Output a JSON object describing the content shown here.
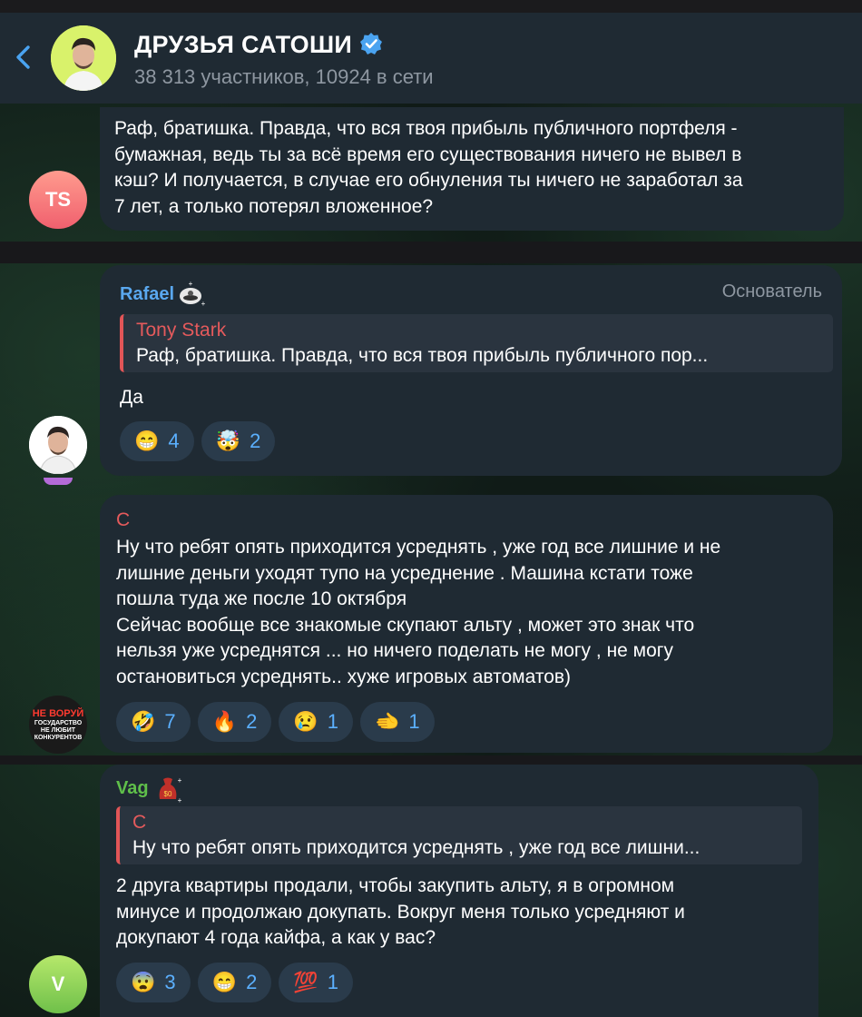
{
  "header": {
    "title": "ДРУЗЬЯ САТОШИ",
    "subtitle": "38 313 участников, 10924 в сети"
  },
  "messages": [
    {
      "avatar_initials": "TS",
      "text": "Раф, братишка. Правда, что вся твоя прибыль публичного портфеля -\nбумажная, ведь ты за всё время его существования ничего не вывел в\nкэш? И получается, в случае его обнуления ты ничего не заработал за\n7 лет, а только потерял вложенное?"
    },
    {
      "author": "Rafael",
      "role": "Основатель",
      "reply": {
        "author": "Tony Stark",
        "text": "Раф, братишка. Правда, что вся твоя прибыль публичного пор..."
      },
      "text": "Да",
      "reactions": [
        {
          "emoji": "😁",
          "count": "4"
        },
        {
          "emoji": "🤯",
          "count": "2"
        }
      ]
    },
    {
      "author": "С",
      "avatar_text": [
        "НЕ ВОРУЙ",
        "ГОСУДАРСТВО",
        "НЕ ЛЮБИТ",
        "КОНКУРЕНТОВ"
      ],
      "text": "Ну что ребят опять приходится усреднять , уже год все лишние и не\nлишние деньги уходят тупо на усреднение . Машина кстати тоже\nпошла туда же после 10 октября\nСейчас вообще все знакомые скупают альту , может это знак что\nнельзя уже усреднятся ... но ничего поделать не могу , не могу\nостановиться усреднять.. хуже игровых автоматов)",
      "reactions": [
        {
          "emoji": "🤣",
          "count": "7"
        },
        {
          "emoji": "🔥",
          "count": "2"
        },
        {
          "emoji": "😢",
          "count": "1"
        },
        {
          "emoji": "🫲",
          "count": "1"
        }
      ]
    },
    {
      "author": "Vag",
      "avatar_initials": "V",
      "reply": {
        "author": "С",
        "text": "Ну что ребят опять приходится усреднять , уже год все лишни..."
      },
      "text": "2 друга квартиры продали, чтобы закупить альту, я в огромном\nминусе и продолжаю докупать. Вокруг меня только усредняют и\nдокупают 4 года кайфа, а как у вас?",
      "reactions": [
        {
          "emoji": "😨",
          "count": "3"
        },
        {
          "emoji": "😁",
          "count": "2"
        },
        {
          "emoji": "💯",
          "count": "1"
        }
      ]
    }
  ],
  "colors": {
    "bubble": "#1f2a33",
    "accent": "#5bb0ff",
    "rafael": "#5aa8ef",
    "red_author": "#e55a5c",
    "vag": "#5fbf4a",
    "role": "#8e97a1"
  }
}
